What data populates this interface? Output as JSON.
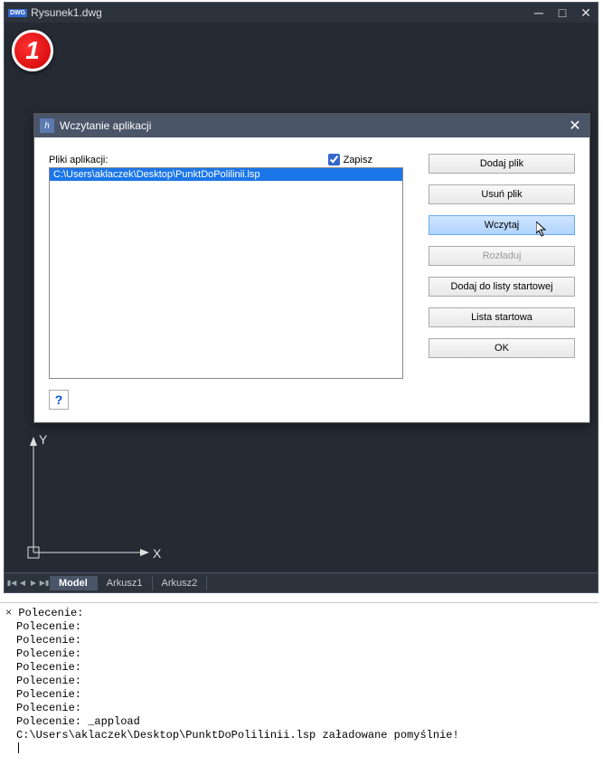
{
  "app": {
    "title": "Rysunek1.dwg"
  },
  "step": {
    "number": "1"
  },
  "axis": {
    "x_label": "X",
    "y_label": "Y"
  },
  "tabs": {
    "items": [
      {
        "label": "Model",
        "active": true
      },
      {
        "label": "Arkusz1",
        "active": false
      },
      {
        "label": "Arkusz2",
        "active": false
      }
    ]
  },
  "dialog": {
    "title": "Wczytanie aplikacji",
    "files_label": "Pliki aplikacji:",
    "save_checkbox": {
      "label": "Zapisz",
      "checked": true
    },
    "file_items": [
      "C:\\Users\\aklaczek\\Desktop\\PunktDoPolilinii.lsp"
    ],
    "buttons": {
      "add": "Dodaj plik",
      "remove": "Usuń plik",
      "load": "Wczytaj",
      "unload": "Rozładuj",
      "add_startup": "Dodaj do listy startowej",
      "startup_list": "Lista startowa",
      "ok": "OK"
    },
    "help": "?"
  },
  "console": {
    "prompt": "Polecenie:",
    "lines": [
      "Polecenie:",
      "Polecenie:",
      "Polecenie:",
      "Polecenie:",
      "Polecenie:",
      "Polecenie:",
      "Polecenie:",
      "Polecenie:",
      "Polecenie: _appload",
      "C:\\Users\\aklaczek\\Desktop\\PunktDoPolilinii.lsp załadowane pomyślnie!"
    ]
  }
}
